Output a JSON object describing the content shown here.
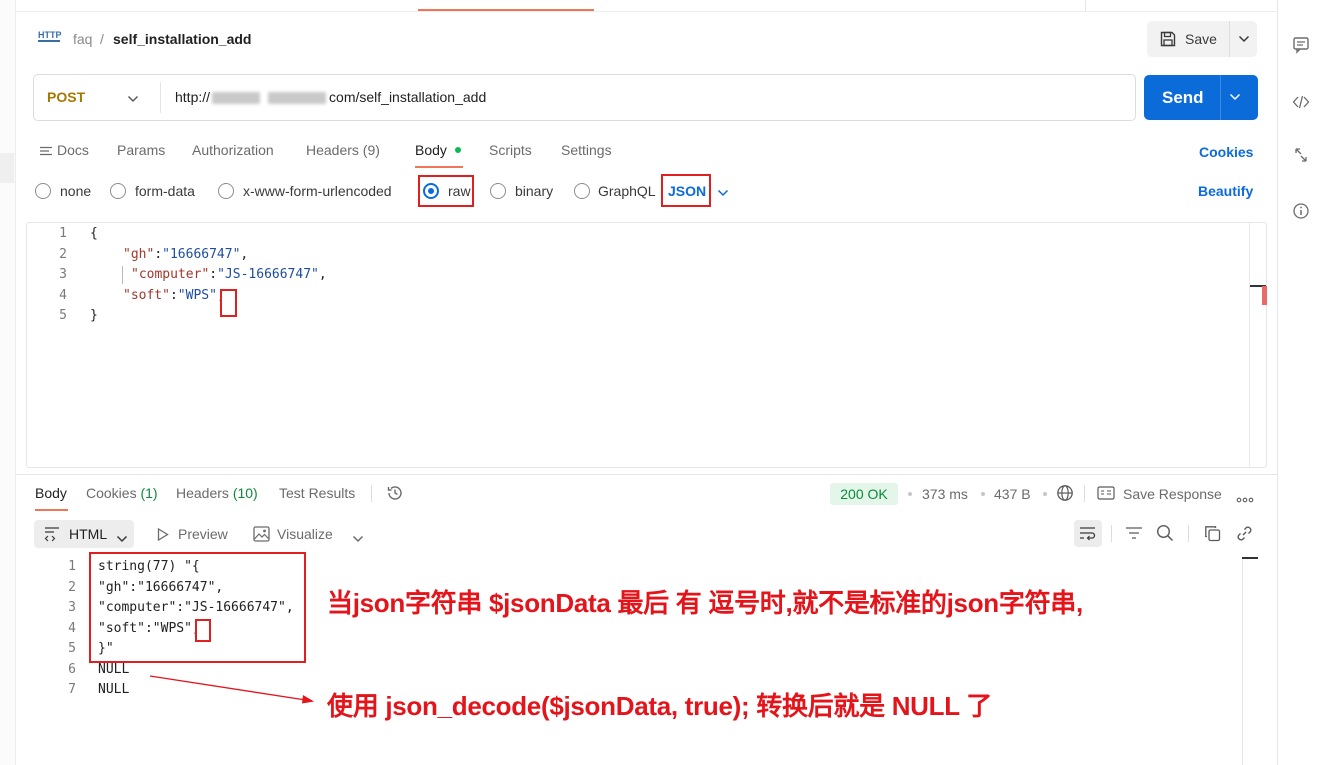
{
  "request": {
    "breadcrumb": {
      "parent": "faq",
      "separator": "/",
      "current": "self_installation_add"
    },
    "http_badge": "HTTP",
    "save_label": "Save",
    "method": "POST",
    "url_prefix": "http://",
    "url_suffix": "com/self_installation_add",
    "send_label": "Send",
    "tabs": [
      {
        "label": "Docs"
      },
      {
        "label": "Params"
      },
      {
        "label": "Authorization"
      },
      {
        "label": "Headers (9)"
      },
      {
        "label": "Body"
      },
      {
        "label": "Scripts"
      },
      {
        "label": "Settings"
      }
    ],
    "cookies_label": "Cookies",
    "body_types": [
      "none",
      "form-data",
      "x-www-form-urlencoded",
      "raw",
      "binary",
      "GraphQL"
    ],
    "selected_body_type": "raw",
    "format": "JSON",
    "beautify_label": "Beautify",
    "code_lines": [
      {
        "n": "1",
        "text": "{"
      },
      {
        "n": "2",
        "key": "\"gh\"",
        "value": "\"16666747\"",
        "tail": ","
      },
      {
        "n": "3",
        "key": "\"computer\"",
        "value": "\"JS-16666747\"",
        "tail": ","
      },
      {
        "n": "4",
        "key": "\"soft\"",
        "value": "\"WPS\"",
        "tail": ","
      },
      {
        "n": "5",
        "text": "}"
      }
    ]
  },
  "response": {
    "tabs": [
      {
        "label": "Body",
        "count": ""
      },
      {
        "label": "Cookies",
        "count": "(1)"
      },
      {
        "label": "Headers",
        "count": "(10)"
      },
      {
        "label": "Test Results",
        "count": ""
      }
    ],
    "status": "200 OK",
    "time": "373 ms",
    "size": "437 B",
    "save_response_label": "Save Response",
    "view_mode": "HTML",
    "preview_label": "Preview",
    "visualize_label": "Visualize",
    "lines": [
      {
        "n": "1",
        "text": "string(77) \"{"
      },
      {
        "n": "2",
        "text": "\"gh\":\"16666747\","
      },
      {
        "n": "3",
        "text": "\"computer\":\"JS-16666747\","
      },
      {
        "n": "4",
        "text": "\"soft\":\"WPS\","
      },
      {
        "n": "5",
        "text": "}\""
      },
      {
        "n": "6",
        "text": "NULL"
      },
      {
        "n": "7",
        "text": "NULL"
      }
    ]
  },
  "annotations": {
    "note_1": "当json字符串  $jsonData 最后 有 逗号时,就不是标准的json字符串,",
    "note_2": "使用  json_decode($jsonData, true); 转换后就是 NULL 了"
  },
  "colors": {
    "accent": "#f0765a",
    "primary": "#0b6bd9",
    "method": "#a67800",
    "success": "#0a8a3a",
    "annotation": "#e4141b"
  }
}
